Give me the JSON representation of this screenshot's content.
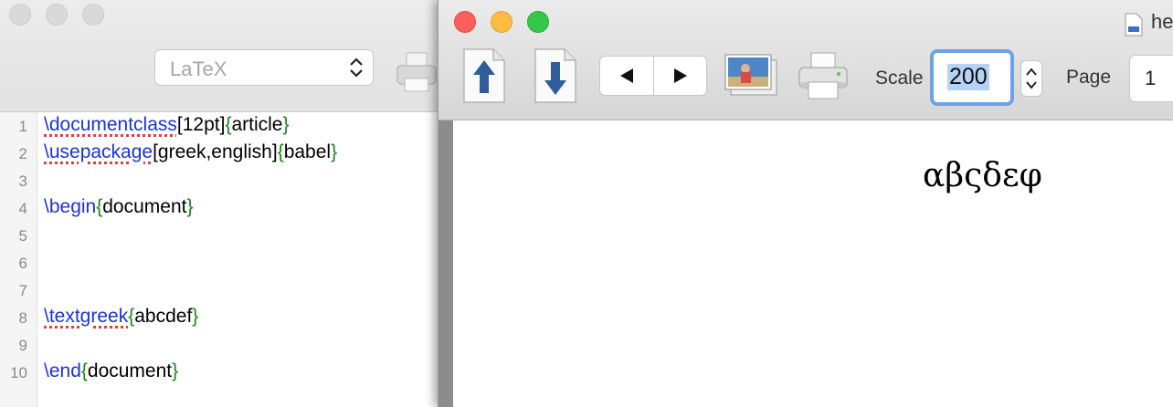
{
  "editor": {
    "typeset_engine": "LaTeX",
    "lines": [
      {
        "n": "1",
        "parts": [
          {
            "t": "\\documentclass",
            "k": "cmd",
            "sp": true
          },
          {
            "t": "[12pt]",
            "k": "txt"
          },
          {
            "t": "{",
            "k": "br"
          },
          {
            "t": "article",
            "k": "txt"
          },
          {
            "t": "}",
            "k": "br"
          }
        ]
      },
      {
        "n": "2",
        "parts": [
          {
            "t": "\\usepackage",
            "k": "cmd",
            "sp": true
          },
          {
            "t": "[greek,english]",
            "k": "txt"
          },
          {
            "t": "{",
            "k": "br"
          },
          {
            "t": "babel",
            "k": "txt"
          },
          {
            "t": "}",
            "k": "br"
          }
        ]
      },
      {
        "n": "3",
        "parts": []
      },
      {
        "n": "4",
        "parts": [
          {
            "t": "\\begin",
            "k": "cmd"
          },
          {
            "t": "{",
            "k": "br"
          },
          {
            "t": "document",
            "k": "txt"
          },
          {
            "t": "}",
            "k": "br"
          }
        ]
      },
      {
        "n": "5",
        "parts": []
      },
      {
        "n": "6",
        "parts": []
      },
      {
        "n": "7",
        "parts": []
      },
      {
        "n": "8",
        "parts": [
          {
            "t": "\\textgreek",
            "k": "cmd",
            "sp": true
          },
          {
            "t": "{",
            "k": "br"
          },
          {
            "t": "abcdef",
            "k": "txt"
          },
          {
            "t": "}",
            "k": "br"
          }
        ]
      },
      {
        "n": "9",
        "parts": []
      },
      {
        "n": "10",
        "parts": [
          {
            "t": "\\end",
            "k": "cmd"
          },
          {
            "t": "{",
            "k": "br"
          },
          {
            "t": "document",
            "k": "txt"
          },
          {
            "t": "}",
            "k": "br"
          }
        ]
      }
    ]
  },
  "preview": {
    "title": "he",
    "toolbar": {
      "scale_label": "Scale",
      "scale_value": "200",
      "page_label": "Page",
      "page_value": "1"
    },
    "output_text": "αβςδεφ"
  },
  "colors": {
    "command": "#1c33d6",
    "brace": "#138a13",
    "spell_underline": "#e0403a",
    "focus_ring": "#6aa3e8"
  },
  "icons": {
    "editor_print": "printer-icon",
    "upload": "arrow-up-document-icon",
    "download": "arrow-down-document-icon",
    "prev": "triangle-left-icon",
    "next": "triangle-right-icon",
    "picture": "photo-icon",
    "print": "printer-icon"
  }
}
